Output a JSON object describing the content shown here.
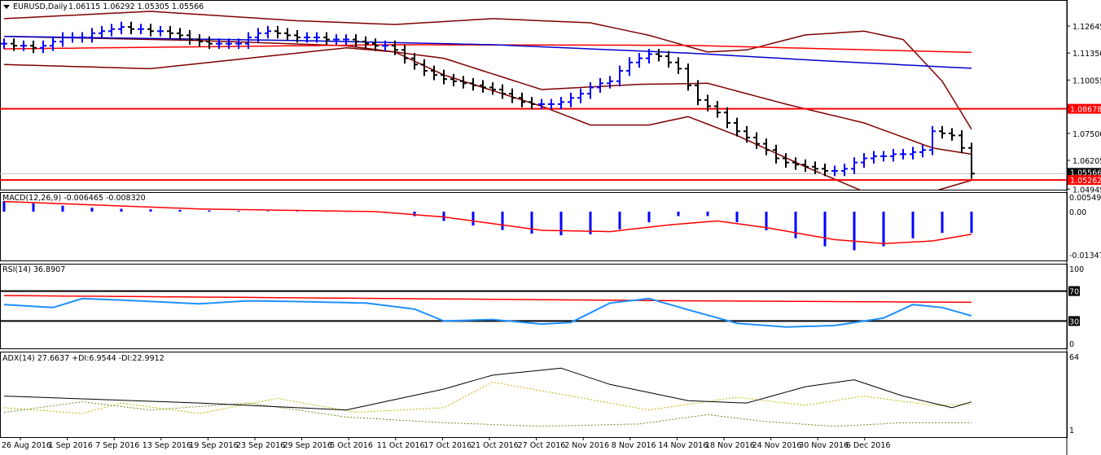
{
  "header": {
    "symbol": "EURUSD,Daily",
    "ohlc": "1.06115 1.06292 1.05305 1.05566"
  },
  "colors": {
    "bull": "#0000ff",
    "bear": "#000000",
    "ma_slow": "#ff0000",
    "ma_fast": "#0000cc",
    "band": "#800000",
    "level": "#ff0000",
    "rsi": "#1e90ff",
    "adx": "#000000",
    "plus_di": "#6b8e23",
    "minus_di": "#c8b400"
  },
  "chart_data": [
    {
      "type": "candlestick",
      "title": "EURUSD,Daily",
      "ylim": [
        1.0475,
        1.1355
      ],
      "price_ticks": [
        "1.12645",
        "1.11350",
        "1.10055",
        "1.08678",
        "1.07500",
        "1.06205",
        "1.05566",
        "1.05262",
        "1.04945"
      ],
      "hlines": [
        {
          "value": 1.08678,
          "label": "1.08678"
        },
        {
          "value": 1.05262,
          "label": "1.05262"
        }
      ],
      "current": {
        "value": 1.05566,
        "label": "1.05566"
      },
      "closes": [
        1.118,
        1.117,
        1.117,
        1.116,
        1.117,
        1.119,
        1.121,
        1.121,
        1.121,
        1.123,
        1.124,
        1.125,
        1.126,
        1.125,
        1.125,
        1.124,
        1.124,
        1.123,
        1.122,
        1.12,
        1.119,
        1.118,
        1.118,
        1.118,
        1.118,
        1.121,
        1.123,
        1.124,
        1.123,
        1.122,
        1.121,
        1.121,
        1.121,
        1.12,
        1.12,
        1.12,
        1.119,
        1.118,
        1.117,
        1.117,
        1.115,
        1.111,
        1.108,
        1.105,
        1.103,
        1.101,
        1.1,
        1.099,
        1.098,
        1.097,
        1.096,
        1.094,
        1.092,
        1.09,
        1.089,
        1.089,
        1.089,
        1.09,
        1.092,
        1.094,
        1.097,
        1.099,
        1.1,
        1.105,
        1.109,
        1.111,
        1.113,
        1.112,
        1.109,
        1.106,
        1.098,
        1.091,
        1.088,
        1.085,
        1.08,
        1.076,
        1.073,
        1.07,
        1.067,
        1.063,
        1.061,
        1.06,
        1.059,
        1.058,
        1.057,
        1.057,
        1.058,
        1.061,
        1.063,
        1.064,
        1.064,
        1.065,
        1.065,
        1.066,
        1.067,
        1.076,
        1.075,
        1.074,
        1.068,
        1.0557
      ],
      "ma_slow": [
        [
          0,
          1.1155
        ],
        [
          40,
          1.1175
        ],
        [
          70,
          1.1172
        ],
        [
          99,
          1.1138
        ]
      ],
      "ma_fast": [
        [
          0,
          1.1215
        ],
        [
          30,
          1.1195
        ],
        [
          50,
          1.1175
        ],
        [
          70,
          1.1135
        ],
        [
          85,
          1.1095
        ],
        [
          99,
          1.1062
        ]
      ],
      "band_upper": [
        [
          0,
          1.13
        ],
        [
          15,
          1.1335
        ],
        [
          30,
          1.129
        ],
        [
          40,
          1.1272
        ],
        [
          50,
          1.13
        ],
        [
          60,
          1.128
        ],
        [
          66,
          1.122
        ],
        [
          72,
          1.114
        ],
        [
          76,
          1.115
        ],
        [
          82,
          1.1222
        ],
        [
          88,
          1.124
        ],
        [
          92,
          1.12
        ],
        [
          96,
          1.1
        ],
        [
          99,
          1.077
        ]
      ],
      "band_mid": [
        [
          0,
          1.1215
        ],
        [
          20,
          1.1195
        ],
        [
          35,
          1.117
        ],
        [
          45,
          1.111
        ],
        [
          55,
          1.096
        ],
        [
          65,
          1.0985
        ],
        [
          72,
          1.099
        ],
        [
          80,
          1.089
        ],
        [
          88,
          1.08
        ],
        [
          95,
          1.068
        ],
        [
          99,
          1.065
        ]
      ],
      "band_lower": [
        [
          0,
          1.108
        ],
        [
          15,
          1.106
        ],
        [
          25,
          1.111
        ],
        [
          35,
          1.116
        ],
        [
          40,
          1.114
        ],
        [
          45,
          1.103
        ],
        [
          55,
          1.088
        ],
        [
          60,
          1.079
        ],
        [
          66,
          1.079
        ],
        [
          70,
          1.083
        ],
        [
          75,
          1.074
        ],
        [
          82,
          1.059
        ],
        [
          88,
          1.047
        ],
        [
          95,
          1.047
        ],
        [
          99,
          1.0525
        ]
      ],
      "dates": [
        "26 Aug 2016",
        "1 Sep 2016",
        "7 Sep 2016",
        "13 Sep 2016",
        "19 Sep 2016",
        "23 Sep 2016",
        "29 Sep 2016",
        "5 Oct 2016",
        "11 Oct 2016",
        "17 Oct 2016",
        "21 Oct 2016",
        "27 Oct 2016",
        "2 Nov 2016",
        "8 Nov 2016",
        "14 Nov 2016",
        "18 Nov 2016",
        "24 Nov 2016",
        "30 Nov 2016",
        "6 Dec 2016"
      ]
    },
    {
      "type": "bar",
      "title": "MACD(12,26,9) -0.006465 -0.008320",
      "ylim": [
        -0.01347,
        0.005498
      ],
      "ticks": [
        "0.005498",
        "0.00",
        "-0.01347"
      ],
      "histogram": [
        [
          0,
          0.004
        ],
        [
          5,
          0.0025
        ],
        [
          10,
          0.0012
        ],
        [
          25,
          0.0002
        ],
        [
          38,
          0.0001
        ],
        [
          40,
          -0.0005
        ],
        [
          45,
          -0.0035
        ],
        [
          52,
          -0.0075
        ],
        [
          56,
          -0.009
        ],
        [
          60,
          -0.0085
        ],
        [
          64,
          -0.006
        ],
        [
          68,
          -0.002
        ],
        [
          71,
          -0.001
        ],
        [
          74,
          -0.003
        ],
        [
          80,
          -0.009
        ],
        [
          86,
          -0.015
        ],
        [
          90,
          -0.013
        ],
        [
          95,
          -0.008
        ],
        [
          99,
          -0.008
        ]
      ],
      "signal": [
        [
          0,
          0.0038
        ],
        [
          20,
          0.001
        ],
        [
          38,
          0.0
        ],
        [
          45,
          -0.002
        ],
        [
          55,
          -0.007
        ],
        [
          62,
          -0.0075
        ],
        [
          68,
          -0.005
        ],
        [
          73,
          -0.0035
        ],
        [
          78,
          -0.006
        ],
        [
          85,
          -0.0105
        ],
        [
          90,
          -0.012
        ],
        [
          95,
          -0.011
        ],
        [
          99,
          -0.0085
        ]
      ]
    },
    {
      "type": "line",
      "title": "RSI(14) 36.8907",
      "ylim": [
        0,
        100
      ],
      "ticks": [
        "100",
        "70",
        "30",
        "0"
      ],
      "levels": [
        70,
        30
      ],
      "rsi": [
        [
          0,
          52
        ],
        [
          5,
          48
        ],
        [
          8,
          60
        ],
        [
          12,
          58
        ],
        [
          20,
          53
        ],
        [
          25,
          57
        ],
        [
          30,
          56
        ],
        [
          37,
          54
        ],
        [
          42,
          46
        ],
        [
          45,
          30
        ],
        [
          50,
          32
        ],
        [
          55,
          26
        ],
        [
          58,
          28
        ],
        [
          62,
          54
        ],
        [
          66,
          60
        ],
        [
          70,
          45
        ],
        [
          75,
          27
        ],
        [
          80,
          22
        ],
        [
          85,
          24
        ],
        [
          90,
          34
        ],
        [
          93,
          52
        ],
        [
          96,
          48
        ],
        [
          99,
          37
        ]
      ],
      "rsi_ma": [
        [
          0,
          64
        ],
        [
          40,
          60
        ],
        [
          70,
          57
        ],
        [
          99,
          55
        ]
      ]
    },
    {
      "type": "line",
      "title": "ADX(14) 27.6637 +DI:6.9544 -DI:22.9912",
      "ylim": [
        1,
        64
      ],
      "ticks": [
        "64",
        "1"
      ],
      "adx": [
        [
          0,
          30
        ],
        [
          10,
          27
        ],
        [
          20,
          24
        ],
        [
          35,
          18
        ],
        [
          45,
          36
        ],
        [
          50,
          48
        ],
        [
          57,
          54
        ],
        [
          62,
          40
        ],
        [
          70,
          26
        ],
        [
          76,
          24
        ],
        [
          82,
          38
        ],
        [
          87,
          44
        ],
        [
          92,
          30
        ],
        [
          97,
          20
        ],
        [
          99,
          25
        ]
      ],
      "plus_di": [
        [
          0,
          16
        ],
        [
          8,
          25
        ],
        [
          15,
          18
        ],
        [
          25,
          24
        ],
        [
          35,
          12
        ],
        [
          45,
          7
        ],
        [
          55,
          4
        ],
        [
          65,
          6
        ],
        [
          72,
          14
        ],
        [
          78,
          8
        ],
        [
          85,
          4
        ],
        [
          92,
          7
        ],
        [
          99,
          7
        ]
      ],
      "minus_di": [
        [
          0,
          20
        ],
        [
          8,
          15
        ],
        [
          12,
          24
        ],
        [
          20,
          15
        ],
        [
          28,
          28
        ],
        [
          36,
          16
        ],
        [
          45,
          20
        ],
        [
          50,
          42
        ],
        [
          58,
          30
        ],
        [
          66,
          18
        ],
        [
          75,
          29
        ],
        [
          82,
          22
        ],
        [
          88,
          30
        ],
        [
          95,
          22
        ],
        [
          99,
          23
        ]
      ]
    }
  ]
}
